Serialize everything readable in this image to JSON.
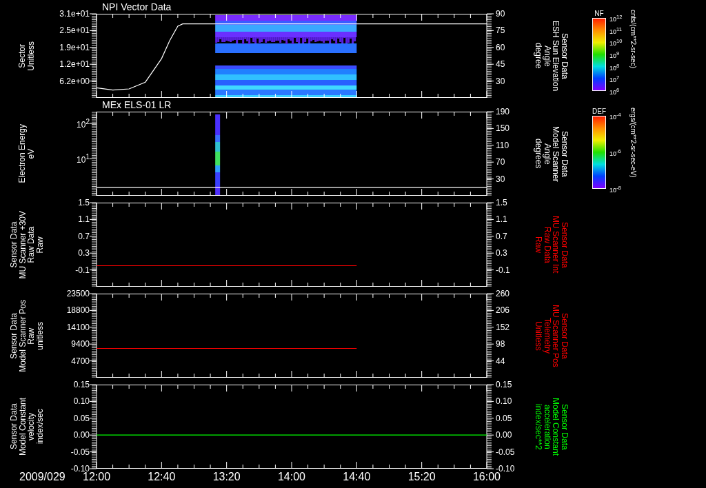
{
  "panels": [
    {
      "title": "NPI Vector Data",
      "left_label": "Sector\nUnitless",
      "left_axis": {
        "kind": "linear",
        "ticks": [
          "3.1e+01",
          "2.5e+01",
          "1.9e+01",
          "1.2e+01",
          "6.2e+00"
        ]
      },
      "spectrogram": {
        "kind": "bands"
      },
      "chart_data": {
        "type": "line",
        "ylabel": "Sensor Data\nESH Sun Elevation\nAngle\ndegree",
        "xlim": [
          12,
          16
        ],
        "ylim": [
          15,
          90
        ],
        "yticks": [
          {
            "value": 90,
            "label": "90"
          },
          {
            "value": 75,
            "label": "75"
          },
          {
            "value": 60,
            "label": "60"
          },
          {
            "value": 45,
            "label": "45"
          },
          {
            "value": 30,
            "label": "30"
          }
        ],
        "x": [
          12,
          12.1667,
          12.3333,
          12.5,
          12.6667,
          12.75,
          12.8333,
          12.8833,
          16
        ],
        "series": [
          {
            "color": "#ffffff",
            "values": [
              24,
              22,
              23,
              29,
              50,
              66,
              79,
              81,
              81
            ]
          }
        ]
      },
      "colorbar": {
        "title": "NF",
        "ticks": [
          "10$^{12}$",
          "10$^{11}$",
          "10$^{10}$",
          "10$^{9}$",
          "10$^{8}$",
          "10$^{7}$",
          "10$^{6}$"
        ],
        "unit": "cnts/(cm**2-sr-sec)"
      }
    },
    {
      "title": "MEx ELS-01 LR",
      "left_label": "Electron Energy\neV",
      "left_axis": {
        "kind": "log",
        "ticks": [
          "10$^{2}$",
          "10$^{1}$"
        ]
      },
      "spectrogram": {
        "kind": "burst"
      },
      "chart_data": {
        "type": "line",
        "ylabel": "Sensor Data\nModel Scanner\nAngle\ndegrees",
        "xlim": [
          12,
          16
        ],
        "ylim": [
          -10,
          190
        ],
        "yticks": [
          {
            "value": 190,
            "label": "190"
          },
          {
            "value": 150,
            "label": "150"
          },
          {
            "value": 110,
            "label": "110"
          },
          {
            "value": 70,
            "label": "70"
          },
          {
            "value": 30,
            "label": "30"
          }
        ],
        "x": [
          12,
          16
        ],
        "series": [
          {
            "color": "#ffffff",
            "values": [
              10,
              10
            ]
          }
        ]
      },
      "colorbar": {
        "title": "DEF",
        "ticks": [
          "10$^{-4}$",
          "10$^{-6}$",
          "10$^{-8}$"
        ],
        "unit": "ergs/(cm**2-sr-sec-eV)"
      }
    },
    {
      "left_label": "Sensor Data\nMU Scanner +30V\nRaw Data\nRaw",
      "left_axis": {
        "kind": "linear",
        "ticks": [
          "1.5",
          "1.1",
          "0.7",
          "0.3",
          "-0.1"
        ]
      },
      "chart_data": {
        "type": "line",
        "ylabel": "Sensor Data\nMU Scanner Int\nRaw Data\nRaw",
        "xlim": [
          12,
          16
        ],
        "ylim": [
          -0.5,
          1.5
        ],
        "yticks": [
          {
            "value": 1.5,
            "label": "1.5"
          },
          {
            "value": 1.1,
            "label": "1.1"
          },
          {
            "value": 0.7,
            "label": "0.7"
          },
          {
            "value": 0.3,
            "label": "0.3"
          },
          {
            "value": -0.1,
            "label": "-0.1"
          }
        ],
        "x": [
          12,
          14.6667
        ],
        "series": [
          {
            "color": "#ff0000",
            "values": [
              0,
              0
            ]
          }
        ]
      }
    },
    {
      "left_label": "Sensor Data\nModel Scanner Pos\nRaw\nunitless",
      "left_axis": {
        "kind": "linear",
        "ticks": [
          "23500",
          "18800",
          "14100",
          "9400",
          "4700"
        ]
      },
      "chart_data": {
        "type": "line",
        "ylabel": "Sensor Data\nMU Scanner Pos\nTelemetry\nUnitless",
        "xlim": [
          12,
          16
        ],
        "ylim": [
          -10,
          260
        ],
        "yticks": [
          {
            "value": 260,
            "label": "260"
          },
          {
            "value": 206,
            "label": "206"
          },
          {
            "value": 152,
            "label": "152"
          },
          {
            "value": 98,
            "label": "98"
          },
          {
            "value": 44,
            "label": "44"
          }
        ],
        "x": [
          12,
          14.6667
        ],
        "series": [
          {
            "color": "#ff0000",
            "values": [
              84,
              84
            ]
          }
        ]
      }
    },
    {
      "left_label": "Sensor Data\nModel Constant\nvelocity\nindex/sec",
      "left_axis": {
        "kind": "linear",
        "ticks": [
          "0.15",
          "0.10",
          "0.05",
          "0.00",
          "-0.05",
          "-0.10"
        ]
      },
      "chart_data": {
        "type": "line",
        "ylabel": "Sensor Data\nModel Constant\nacceleration\nindex/sec**2",
        "xlim": [
          12,
          16
        ],
        "ylim": [
          -0.1,
          0.15
        ],
        "yticks": [
          {
            "value": 0.15,
            "label": "0.15"
          },
          {
            "value": 0.1,
            "label": "0.10"
          },
          {
            "value": 0.05,
            "label": "0.05"
          },
          {
            "value": 0,
            "label": "0.00"
          },
          {
            "value": -0.05,
            "label": "-0.05"
          },
          {
            "value": -0.1,
            "label": "-0.10"
          }
        ],
        "xticks": [
          {
            "value": 12,
            "label": "12:00"
          },
          {
            "value": 12.6667,
            "label": "12:40"
          },
          {
            "value": 13.3333,
            "label": "13:20"
          },
          {
            "value": 14,
            "label": "14:00"
          },
          {
            "value": 14.6667,
            "label": "14:40"
          },
          {
            "value": 15.3333,
            "label": "15:20"
          },
          {
            "value": 16,
            "label": "16:00"
          }
        ],
        "x": [
          12,
          16
        ],
        "series": [
          {
            "color": "#00ff00",
            "values": [
              0,
              0
            ]
          }
        ]
      }
    }
  ],
  "date": "2009/029"
}
